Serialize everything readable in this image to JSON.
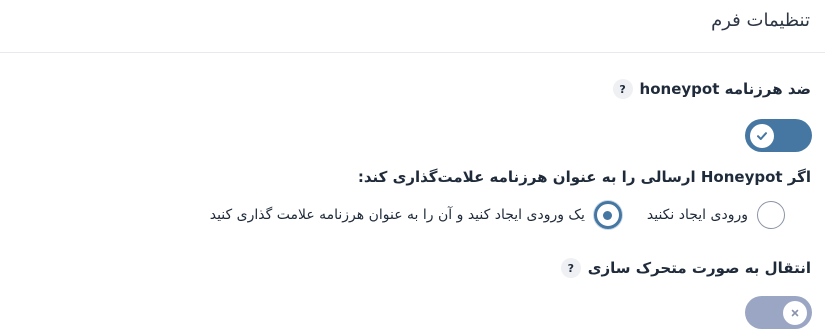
{
  "page": {
    "title": "تنظیمات فرم"
  },
  "honeypot": {
    "label": "ضد هرزنامه honeypot",
    "help": "?",
    "enabled": true,
    "question": "اگر Honeypot ارسالی را به عنوان هرزنامه علامت‌گذاری کند:",
    "options": [
      {
        "label": "ورودی ایجاد نکنید",
        "selected": false
      },
      {
        "label": "یک ورودی ایجاد کنید و آن را به عنوان هرزنامه علامت گذاری کنید",
        "selected": true
      }
    ]
  },
  "animation": {
    "label": "انتقال به صورت متحرک سازی",
    "help": "?",
    "enabled": false
  },
  "colors": {
    "accent": "#4577a2",
    "toggle_off": "#9ba6c4"
  },
  "icons": {
    "toggle_on": "check-icon",
    "toggle_off": "close-icon"
  }
}
